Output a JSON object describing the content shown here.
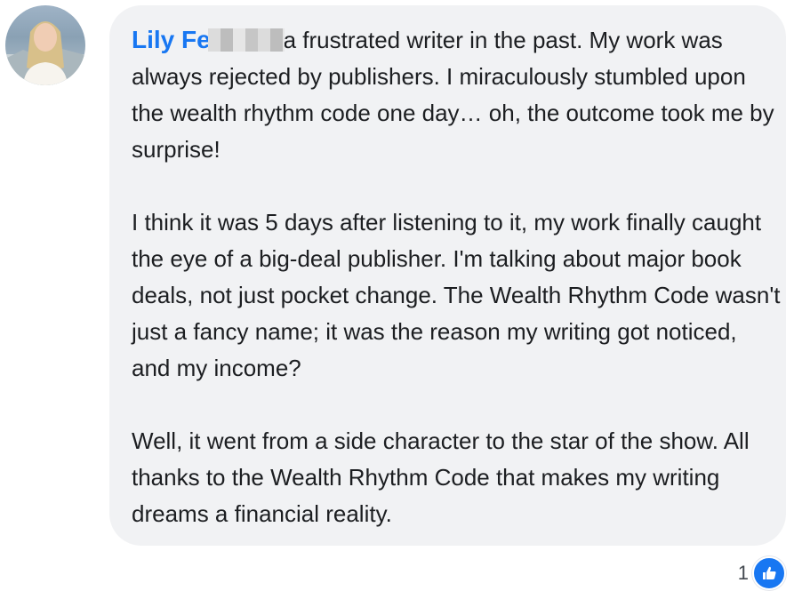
{
  "comment": {
    "author": "Lily Fe",
    "paragraphs": [
      "I was a frustrated writer in the past. My work was always rejected by publishers. I miraculously stumbled upon the wealth rhythm code one day… oh, the outcome took me by surprise!",
      "I think it was 5 days after listening to it, my work finally caught the eye of a big-deal publisher. I'm talking about major book deals, not just pocket change. The Wealth Rhythm Code wasn't just a fancy name; it was the reason my writing got noticed, and my income?",
      "Well, it went from a side character to the star of the show. All thanks to the Wealth Rhythm Code that makes my writing dreams a financial reality."
    ]
  },
  "reactions": {
    "count": "1",
    "icon": "thumbs-up-icon",
    "color": "#1877f2"
  }
}
